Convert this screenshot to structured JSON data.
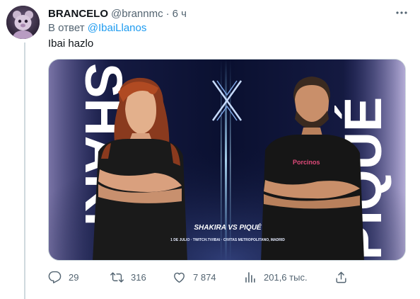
{
  "tweet": {
    "display_name": "BRANCELO",
    "handle": "@brannmc",
    "separator": "·",
    "time": "6 ч",
    "reply_prefix": "В ответ",
    "reply_mention": "@IbaiLlanos",
    "text": "Ibai hazlo"
  },
  "media": {
    "left_name": "SHAKI",
    "right_name": "PIQUÉ",
    "center_logo": "X",
    "matchup": "SHAKIRA VS PIQUÉ",
    "event_info": "1 DE JULIO · TWITCH.TV/IBAI · CIVITAS METROPOLITANO, MADRID",
    "shirt_text": "Porcinos"
  },
  "actions": {
    "replies": "29",
    "retweets": "316",
    "likes": "7 874",
    "views": "201,6 тыс."
  },
  "colors": {
    "link": "#1d9bf0",
    "muted": "#536471",
    "text": "#0f1419",
    "media_bg": "#0b1230"
  },
  "icons": {
    "more": "more-dots-icon",
    "reply": "reply-icon",
    "retweet": "retweet-icon",
    "like": "like-icon",
    "views": "views-icon",
    "share": "share-icon"
  }
}
